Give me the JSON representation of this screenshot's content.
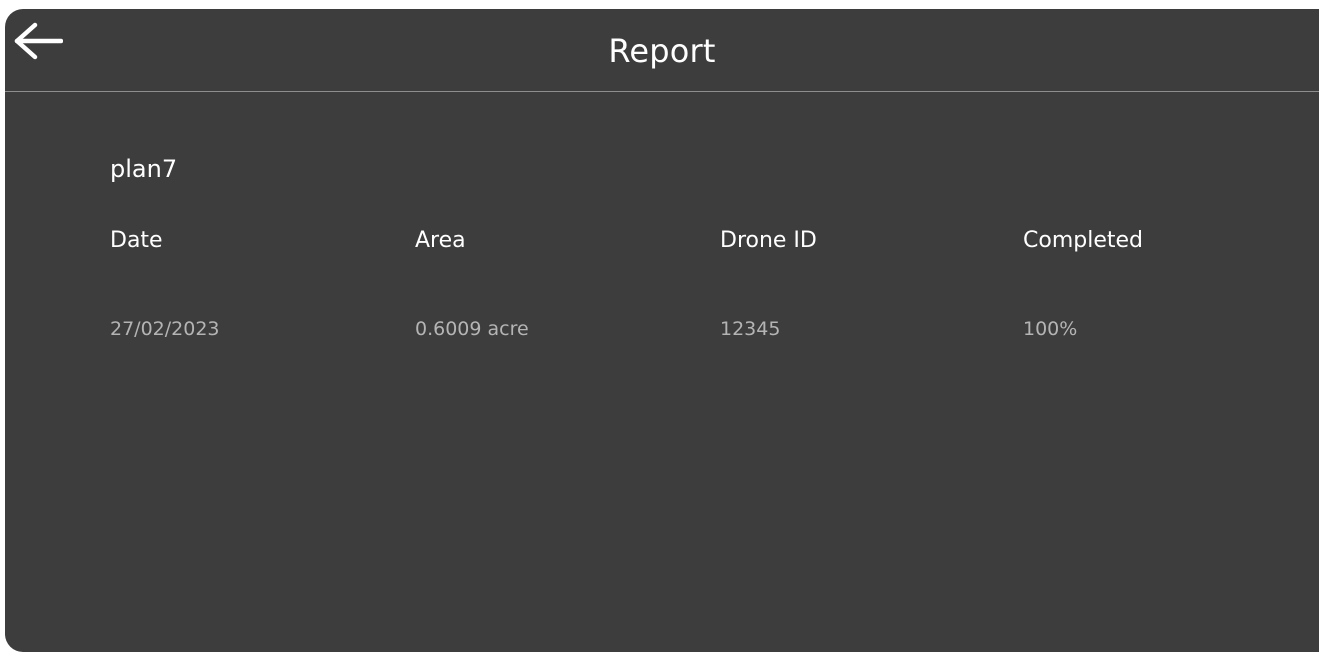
{
  "header": {
    "title": "Report",
    "back_icon": "arrow-left-icon"
  },
  "plan": {
    "name": "plan7"
  },
  "table": {
    "columns": [
      "Date",
      "Area",
      "Drone ID",
      "Completed"
    ],
    "rows": [
      [
        "27/02/2023",
        "0.6009 acre",
        "12345",
        "100%"
      ]
    ]
  },
  "colors": {
    "background": "#3d3d3d",
    "primary_text": "#ffffff",
    "secondary_text": "#b4b4b4",
    "divider": "#8e8e8e"
  }
}
